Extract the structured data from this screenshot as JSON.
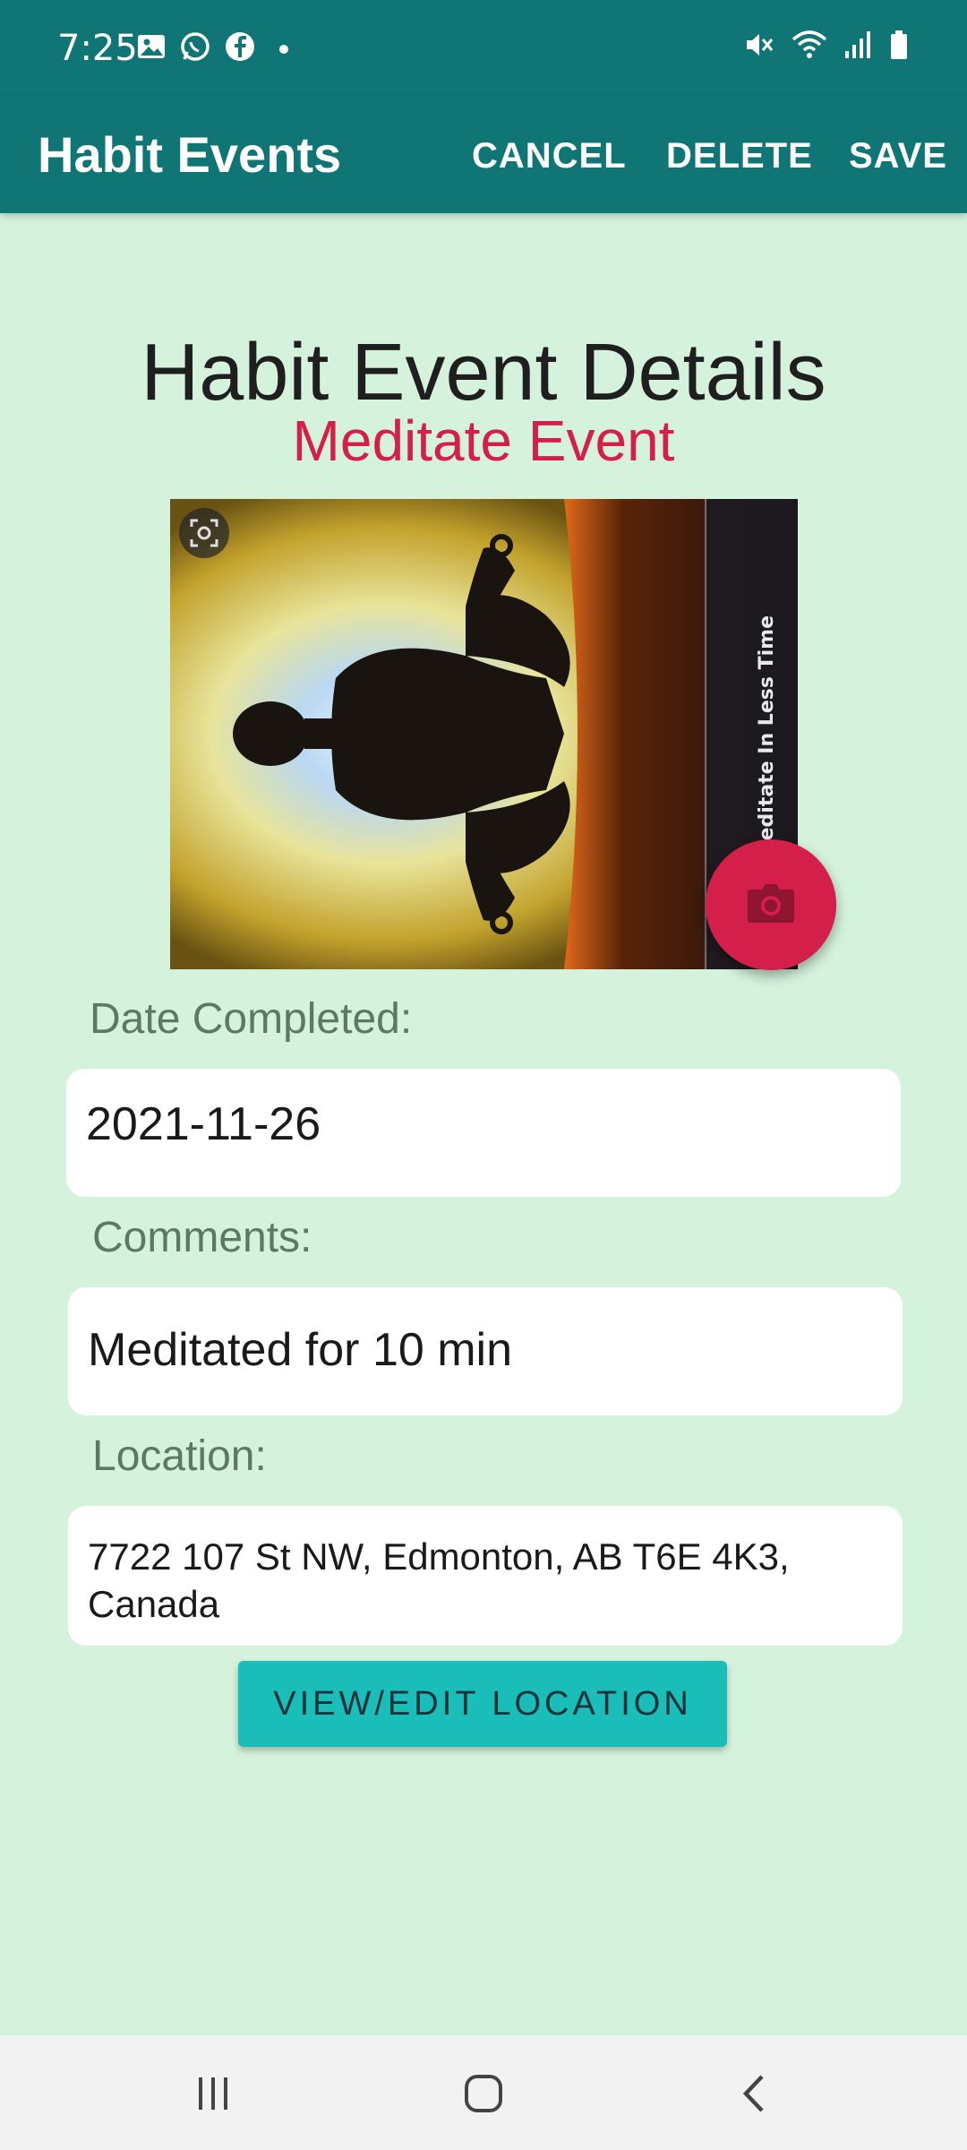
{
  "status_bar": {
    "time": "7:25",
    "left_icons": [
      "gallery-icon",
      "whatsapp-icon",
      "facebook-icon",
      "dot-icon"
    ],
    "right_icons": [
      "mute-icon",
      "wifi-icon",
      "signal-icon",
      "battery-icon"
    ]
  },
  "app_bar": {
    "title": "Habit Events",
    "actions": {
      "cancel": "CANCEL",
      "delete": "DELETE",
      "save": "SAVE"
    },
    "background_color": "#0f7575"
  },
  "content": {
    "page_title": "Habit Event Details",
    "habit_name": "Meditate Event",
    "photo": {
      "overlay_text": "o Meditate In Less Time",
      "icon": "focus-icon"
    },
    "camera_button_icon": "camera-icon",
    "date": {
      "label": "Date Completed:",
      "value": "2021-11-26"
    },
    "comments": {
      "label": "Comments:",
      "value": "Meditated for 10 min"
    },
    "location": {
      "label": "Location:",
      "value_line1": "7722 107 St NW, Edmonton, AB T6E 4K3,",
      "value_line2": "Canada"
    },
    "location_button": "VIEW/EDIT LOCATION"
  },
  "colors": {
    "background": "#d4f2dc",
    "accent": "#d41f4a",
    "button": "#1bbdb8"
  },
  "nav_bar": {
    "icons": [
      "recent-apps-icon",
      "home-icon",
      "back-icon"
    ]
  }
}
